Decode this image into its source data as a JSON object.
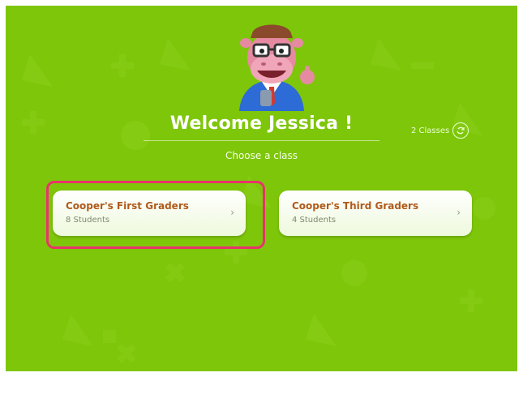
{
  "header": {
    "welcome": "Welcome Jessica !",
    "classes_count": "2 Classes",
    "refresh_icon": "refresh-icon"
  },
  "subtitle": "Choose a class",
  "classes": [
    {
      "name": "Cooper's First Graders",
      "students": "8 Students",
      "selected": true
    },
    {
      "name": "Cooper's Third Graders",
      "students": "4 Students",
      "selected": false
    }
  ],
  "colors": {
    "background": "#7ec60a",
    "card_title": "#b05a1a",
    "highlight": "#e8336b"
  },
  "icons": {
    "mascot": "hippo-mascot",
    "chevron": "chevron-right-icon"
  }
}
